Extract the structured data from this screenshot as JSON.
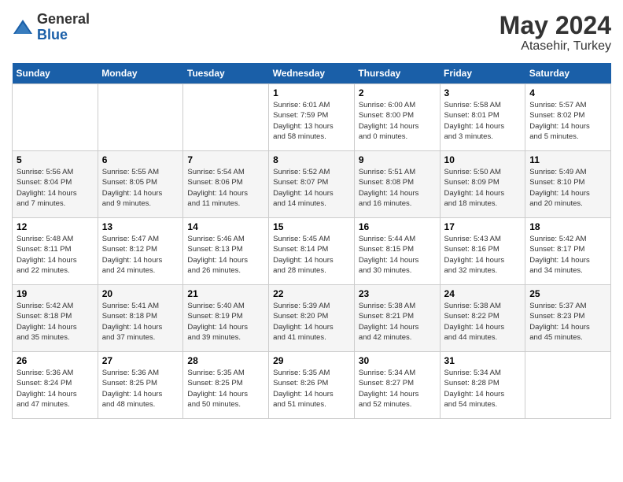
{
  "header": {
    "logo_general": "General",
    "logo_blue": "Blue",
    "month": "May 2024",
    "location": "Atasehir, Turkey"
  },
  "weekdays": [
    "Sunday",
    "Monday",
    "Tuesday",
    "Wednesday",
    "Thursday",
    "Friday",
    "Saturday"
  ],
  "weeks": [
    [
      {
        "num": "",
        "info": ""
      },
      {
        "num": "",
        "info": ""
      },
      {
        "num": "",
        "info": ""
      },
      {
        "num": "1",
        "info": "Sunrise: 6:01 AM\nSunset: 7:59 PM\nDaylight: 13 hours\nand 58 minutes."
      },
      {
        "num": "2",
        "info": "Sunrise: 6:00 AM\nSunset: 8:00 PM\nDaylight: 14 hours\nand 0 minutes."
      },
      {
        "num": "3",
        "info": "Sunrise: 5:58 AM\nSunset: 8:01 PM\nDaylight: 14 hours\nand 3 minutes."
      },
      {
        "num": "4",
        "info": "Sunrise: 5:57 AM\nSunset: 8:02 PM\nDaylight: 14 hours\nand 5 minutes."
      }
    ],
    [
      {
        "num": "5",
        "info": "Sunrise: 5:56 AM\nSunset: 8:04 PM\nDaylight: 14 hours\nand 7 minutes."
      },
      {
        "num": "6",
        "info": "Sunrise: 5:55 AM\nSunset: 8:05 PM\nDaylight: 14 hours\nand 9 minutes."
      },
      {
        "num": "7",
        "info": "Sunrise: 5:54 AM\nSunset: 8:06 PM\nDaylight: 14 hours\nand 11 minutes."
      },
      {
        "num": "8",
        "info": "Sunrise: 5:52 AM\nSunset: 8:07 PM\nDaylight: 14 hours\nand 14 minutes."
      },
      {
        "num": "9",
        "info": "Sunrise: 5:51 AM\nSunset: 8:08 PM\nDaylight: 14 hours\nand 16 minutes."
      },
      {
        "num": "10",
        "info": "Sunrise: 5:50 AM\nSunset: 8:09 PM\nDaylight: 14 hours\nand 18 minutes."
      },
      {
        "num": "11",
        "info": "Sunrise: 5:49 AM\nSunset: 8:10 PM\nDaylight: 14 hours\nand 20 minutes."
      }
    ],
    [
      {
        "num": "12",
        "info": "Sunrise: 5:48 AM\nSunset: 8:11 PM\nDaylight: 14 hours\nand 22 minutes."
      },
      {
        "num": "13",
        "info": "Sunrise: 5:47 AM\nSunset: 8:12 PM\nDaylight: 14 hours\nand 24 minutes."
      },
      {
        "num": "14",
        "info": "Sunrise: 5:46 AM\nSunset: 8:13 PM\nDaylight: 14 hours\nand 26 minutes."
      },
      {
        "num": "15",
        "info": "Sunrise: 5:45 AM\nSunset: 8:14 PM\nDaylight: 14 hours\nand 28 minutes."
      },
      {
        "num": "16",
        "info": "Sunrise: 5:44 AM\nSunset: 8:15 PM\nDaylight: 14 hours\nand 30 minutes."
      },
      {
        "num": "17",
        "info": "Sunrise: 5:43 AM\nSunset: 8:16 PM\nDaylight: 14 hours\nand 32 minutes."
      },
      {
        "num": "18",
        "info": "Sunrise: 5:42 AM\nSunset: 8:17 PM\nDaylight: 14 hours\nand 34 minutes."
      }
    ],
    [
      {
        "num": "19",
        "info": "Sunrise: 5:42 AM\nSunset: 8:18 PM\nDaylight: 14 hours\nand 35 minutes."
      },
      {
        "num": "20",
        "info": "Sunrise: 5:41 AM\nSunset: 8:18 PM\nDaylight: 14 hours\nand 37 minutes."
      },
      {
        "num": "21",
        "info": "Sunrise: 5:40 AM\nSunset: 8:19 PM\nDaylight: 14 hours\nand 39 minutes."
      },
      {
        "num": "22",
        "info": "Sunrise: 5:39 AM\nSunset: 8:20 PM\nDaylight: 14 hours\nand 41 minutes."
      },
      {
        "num": "23",
        "info": "Sunrise: 5:38 AM\nSunset: 8:21 PM\nDaylight: 14 hours\nand 42 minutes."
      },
      {
        "num": "24",
        "info": "Sunrise: 5:38 AM\nSunset: 8:22 PM\nDaylight: 14 hours\nand 44 minutes."
      },
      {
        "num": "25",
        "info": "Sunrise: 5:37 AM\nSunset: 8:23 PM\nDaylight: 14 hours\nand 45 minutes."
      }
    ],
    [
      {
        "num": "26",
        "info": "Sunrise: 5:36 AM\nSunset: 8:24 PM\nDaylight: 14 hours\nand 47 minutes."
      },
      {
        "num": "27",
        "info": "Sunrise: 5:36 AM\nSunset: 8:25 PM\nDaylight: 14 hours\nand 48 minutes."
      },
      {
        "num": "28",
        "info": "Sunrise: 5:35 AM\nSunset: 8:25 PM\nDaylight: 14 hours\nand 50 minutes."
      },
      {
        "num": "29",
        "info": "Sunrise: 5:35 AM\nSunset: 8:26 PM\nDaylight: 14 hours\nand 51 minutes."
      },
      {
        "num": "30",
        "info": "Sunrise: 5:34 AM\nSunset: 8:27 PM\nDaylight: 14 hours\nand 52 minutes."
      },
      {
        "num": "31",
        "info": "Sunrise: 5:34 AM\nSunset: 8:28 PM\nDaylight: 14 hours\nand 54 minutes."
      },
      {
        "num": "",
        "info": ""
      }
    ]
  ]
}
